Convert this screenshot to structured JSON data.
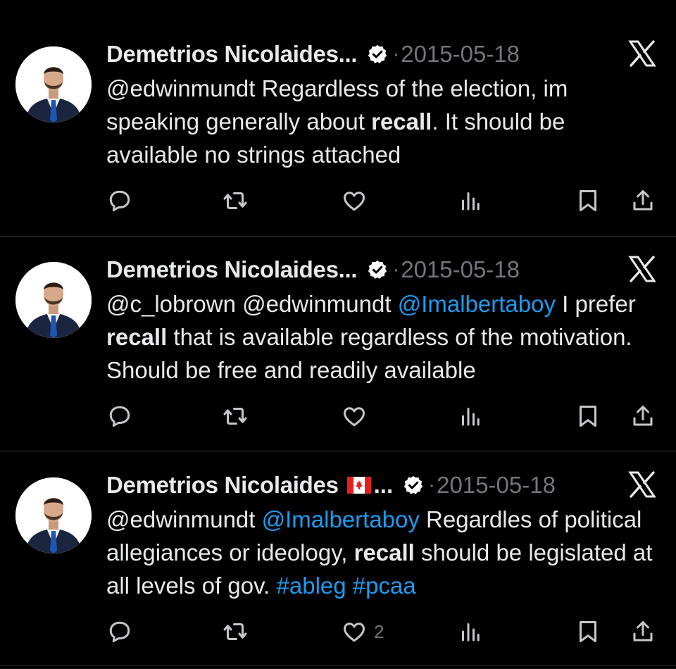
{
  "colors": {
    "background": "#000000",
    "text": "#e7e9ea",
    "muted": "#71767b",
    "link": "#1d9bf0",
    "verified": "#ffffff"
  },
  "tweets": [
    {
      "name": "Demetrios Nicolaides...",
      "show_flag": false,
      "ellipsis": "",
      "separator": "·",
      "date": "2015-05-18",
      "segments": [
        {
          "t": "@edwinmundt Regardless of the election, im speaking generally about ",
          "s": "plain"
        },
        {
          "t": "recall",
          "s": "bold"
        },
        {
          "t": ". It should be available no strings attached",
          "s": "plain"
        }
      ],
      "like_count": ""
    },
    {
      "name": "Demetrios Nicolaides...",
      "show_flag": false,
      "ellipsis": "",
      "separator": "·",
      "date": "2015-05-18",
      "segments": [
        {
          "t": "@c_lobrown @edwinmundt ",
          "s": "plain"
        },
        {
          "t": "@Imalbertaboy",
          "s": "link"
        },
        {
          "t": " I prefer ",
          "s": "plain"
        },
        {
          "t": "recall",
          "s": "bold"
        },
        {
          "t": " that is available regardless of the motivation. Should be free and readily available",
          "s": "plain"
        }
      ],
      "like_count": ""
    },
    {
      "name": "Demetrios Nicolaides",
      "show_flag": true,
      "ellipsis": "...",
      "separator": "·",
      "date": "2015-05-18",
      "segments": [
        {
          "t": "@edwinmundt ",
          "s": "plain"
        },
        {
          "t": "@Imalbertaboy",
          "s": "link"
        },
        {
          "t": " Regardles of political allegiances or ideology, ",
          "s": "plain"
        },
        {
          "t": "recall",
          "s": "bold"
        },
        {
          "t": " should be legislated at all levels of gov. ",
          "s": "plain"
        },
        {
          "t": "#ableg",
          "s": "link"
        },
        {
          "t": " ",
          "s": "plain"
        },
        {
          "t": "#pcaa",
          "s": "link"
        }
      ],
      "like_count": "2"
    }
  ],
  "icons": [
    "reply-icon",
    "retweet-icon",
    "like-icon",
    "views-icon",
    "bookmark-icon",
    "share-icon",
    "verified-badge-icon",
    "x-logo-icon",
    "canada-flag-icon"
  ]
}
